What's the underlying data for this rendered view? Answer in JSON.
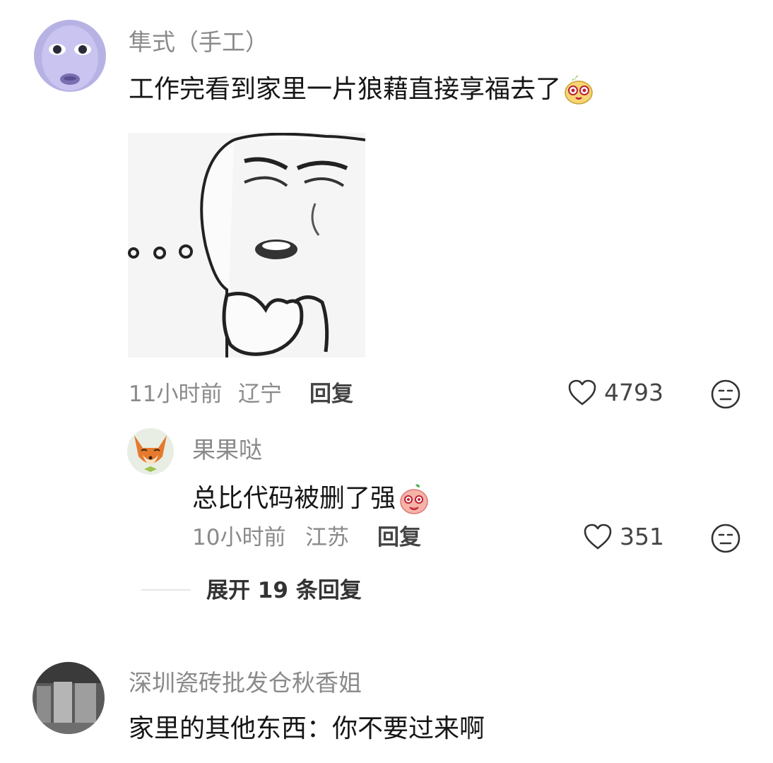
{
  "comments": [
    {
      "author": "隼式（手工）",
      "text": "工作完看到家里一片狼藉直接享福去了",
      "time": "11小时前",
      "location": "辽宁",
      "reply_label": "回复",
      "likes": "4793",
      "replies": [
        {
          "author": "果果哒",
          "text": "总比代码被删了强",
          "time": "10小时前",
          "location": "江苏",
          "reply_label": "回复",
          "likes": "351"
        }
      ],
      "expand_label": "展开 19 条回复"
    },
    {
      "author": "深圳瓷砖批发仓秋香姐",
      "text": "家里的其他东西：你不要过来啊"
    }
  ]
}
